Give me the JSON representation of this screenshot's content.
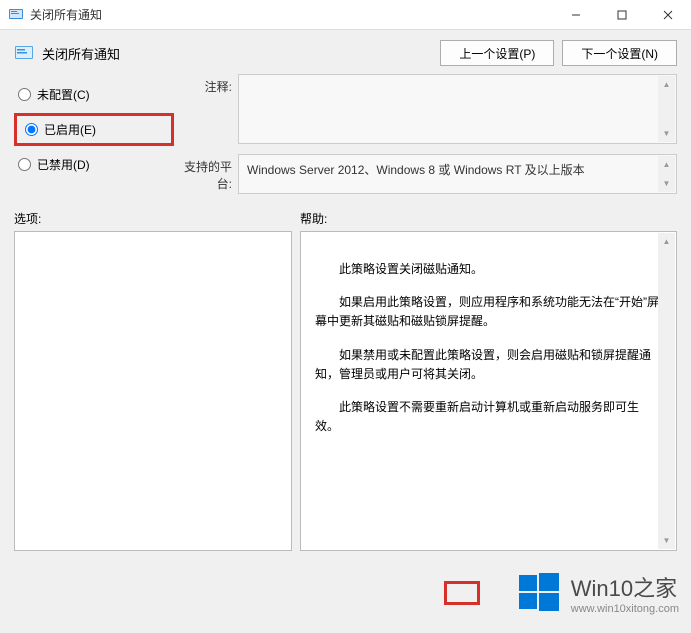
{
  "titlebar": {
    "title": "关闭所有通知"
  },
  "header": {
    "title": "关闭所有通知",
    "prev_btn": "上一个设置(P)",
    "next_btn": "下一个设置(N)"
  },
  "radios": {
    "not_configured": "未配置(C)",
    "enabled": "已启用(E)",
    "disabled": "已禁用(D)"
  },
  "fields": {
    "comment_label": "注释:",
    "comment_value": "",
    "platform_label": "支持的平台:",
    "platform_value": "Windows Server 2012、Windows 8 或 Windows RT 及以上版本"
  },
  "panels": {
    "options_label": "选项:",
    "help_label": "帮助:"
  },
  "help": {
    "p1": "此策略设置关闭磁贴通知。",
    "p2": "如果启用此策略设置，则应用程序和系统功能无法在“开始”屏幕中更新其磁贴和磁贴锁屏提醒。",
    "p3": "如果禁用或未配置此策略设置，则会启用磁贴和锁屏提醒通知，管理员或用户可将其关闭。",
    "p4": "此策略设置不需要重新启动计算机或重新启动服务即可生效。"
  },
  "watermark": {
    "title": "Win10之家",
    "url": "www.win10xitong.com"
  }
}
